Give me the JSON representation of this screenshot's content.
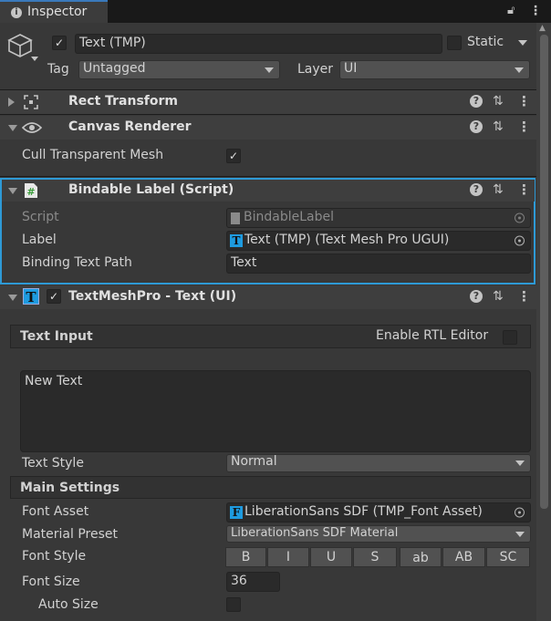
{
  "tab": {
    "title": "Inspector"
  },
  "header": {
    "object_name": "Text (TMP)",
    "static_label": "Static",
    "tag_label": "Tag",
    "tag_value": "Untagged",
    "layer_label": "Layer",
    "layer_value": "UI"
  },
  "components": {
    "rect_transform": {
      "title": "Rect Transform"
    },
    "canvas_renderer": {
      "title": "Canvas Renderer",
      "cull_label": "Cull Transparent Mesh"
    },
    "bindable": {
      "title": "Bindable Label (Script)",
      "script_label": "Script",
      "script_value": "BindableLabel",
      "label_label": "Label",
      "label_value": "Text (TMP) (Text Mesh Pro UGUI)",
      "path_label": "Binding Text Path",
      "path_value": "Text"
    },
    "tmp": {
      "title": "TextMeshPro - Text (UI)",
      "text_input_title": "Text Input",
      "rtl_label": "Enable RTL Editor",
      "text_value": "New Text",
      "text_style_label": "Text Style",
      "text_style_value": "Normal",
      "main_settings_title": "Main Settings",
      "font_asset_label": "Font Asset",
      "font_asset_value": "LiberationSans SDF (TMP_Font Asset)",
      "material_label": "Material Preset",
      "material_value": "LiberationSans SDF Material",
      "font_style_label": "Font Style",
      "font_style_buttons": [
        "B",
        "I",
        "U",
        "S",
        "ab",
        "AB",
        "SC"
      ],
      "font_size_label": "Font Size",
      "font_size_value": "36",
      "auto_size_label": "Auto Size"
    }
  },
  "colors": {
    "accent": "#3a79bb",
    "selected_outline": "#2e9ad6",
    "tmp_icon": "#1e9be0"
  }
}
